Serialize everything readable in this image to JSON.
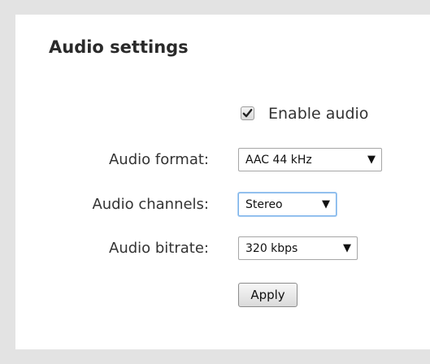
{
  "panel": {
    "title": "Audio settings"
  },
  "enable_audio": {
    "label": "Enable audio",
    "checked": true
  },
  "fields": {
    "format": {
      "label": "Audio format:",
      "value": "AAC 44 kHz"
    },
    "channels": {
      "label": "Audio channels:",
      "value": "Stereo"
    },
    "bitrate": {
      "label": "Audio bitrate:",
      "value": "320 kbps"
    }
  },
  "dropdown_arrow_glyph": "▼",
  "apply_label": "Apply",
  "icons": {
    "checkbox": "checkmark-icon",
    "dropdown": "chevron-down-icon"
  },
  "colors": {
    "background": "#e3e3e3",
    "panel": "#ffffff",
    "focus_ring": "#7eb4ea"
  }
}
